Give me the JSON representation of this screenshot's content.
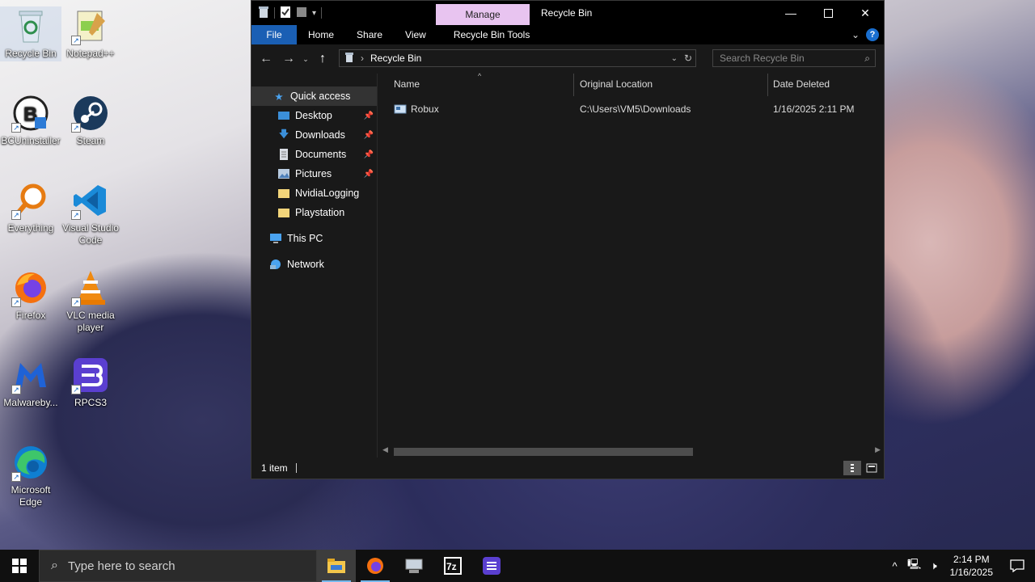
{
  "desktop": {
    "icons": [
      {
        "label": "Recycle Bin",
        "icon": "recycle-bin-icon"
      },
      {
        "label": "Notepad++",
        "icon": "notepadpp-icon"
      },
      {
        "label": "BCUninstaller",
        "icon": "bcuninstaller-icon"
      },
      {
        "label": "Steam",
        "icon": "steam-icon"
      },
      {
        "label": "Everything",
        "icon": "everything-icon"
      },
      {
        "label": "Visual Studio Code",
        "icon": "vscode-icon"
      },
      {
        "label": "Firefox",
        "icon": "firefox-icon"
      },
      {
        "label": "VLC media player",
        "icon": "vlc-icon"
      },
      {
        "label": "Malwareby...",
        "icon": "malwarebytes-icon"
      },
      {
        "label": "RPCS3",
        "icon": "rpcs3-icon"
      },
      {
        "label": "Microsoft Edge",
        "icon": "edge-icon"
      }
    ]
  },
  "window": {
    "title": "Recycle Bin",
    "contextual_tab": "Manage",
    "ribbon_tabs": [
      "File",
      "Home",
      "Share",
      "View",
      "Recycle Bin Tools"
    ],
    "address": "Recycle Bin",
    "search_placeholder": "Search Recycle Bin",
    "nav": {
      "quick_access": "Quick access",
      "pinned": [
        {
          "label": "Desktop"
        },
        {
          "label": "Downloads"
        },
        {
          "label": "Documents"
        },
        {
          "label": "Pictures"
        }
      ],
      "folders": [
        {
          "label": "NvidiaLogging"
        },
        {
          "label": "Playstation"
        }
      ],
      "this_pc": "This PC",
      "network": "Network"
    },
    "columns": [
      "Name",
      "Original Location",
      "Date Deleted"
    ],
    "rows": [
      {
        "name": "Robux",
        "location": "C:\\Users\\VM5\\Downloads",
        "date": "1/16/2025 2:11 PM"
      }
    ],
    "status": "1 item"
  },
  "taskbar": {
    "search_placeholder": "Type here to search",
    "time": "2:14 PM",
    "date": "1/16/2025",
    "accent": "#76b9ed"
  }
}
